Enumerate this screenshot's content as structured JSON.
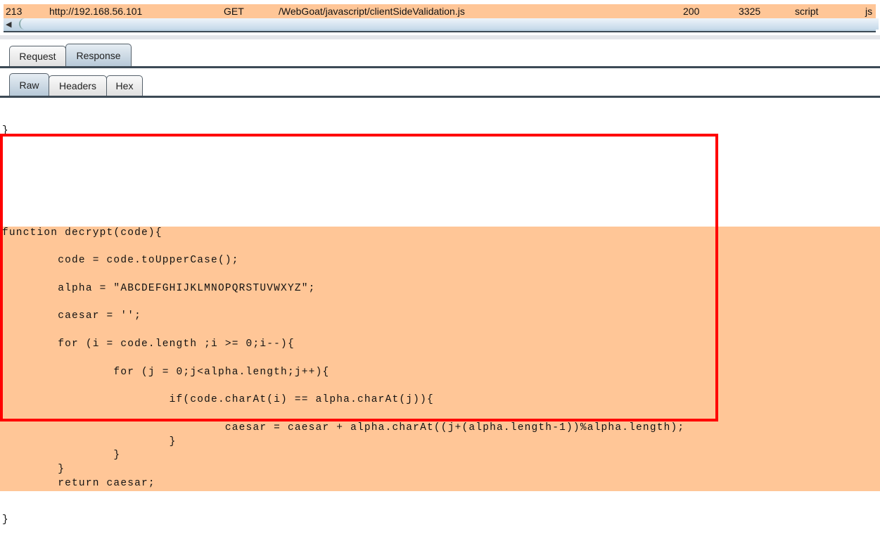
{
  "history_row": {
    "id": "213",
    "host": "http://192.168.56.101",
    "method": "GET",
    "url": "/WebGoat/javascript/clientSideValidation.js",
    "status": "200",
    "length": "3325",
    "mime": "script",
    "ext": "js"
  },
  "colors": {
    "highlight": "#ffc697",
    "box": "#ff0000"
  },
  "tabs": {
    "request": "Request",
    "response": "Response"
  },
  "subtabs": {
    "raw": "Raw",
    "headers": "Headers",
    "hex": "Hex"
  },
  "code_before": [
    "}",
    ""
  ],
  "code": [
    "function decrypt(code){",
    "",
    "        code = code.toUpperCase();",
    "",
    "        alpha = \"ABCDEFGHIJKLMNOPQRSTUVWXYZ\";",
    "",
    "        caesar = '';",
    "",
    "        for (i = code.length ;i >= 0;i--){",
    "",
    "                for (j = 0;j<alpha.length;j++){",
    "",
    "                        if(code.charAt(i) == alpha.charAt(j)){",
    "",
    "                                caesar = caesar + alpha.charAt((j+(alpha.length-1))%alpha.length);",
    "                        }",
    "                }",
    "        }",
    "        return caesar;"
  ],
  "code_after": [
    "}"
  ]
}
